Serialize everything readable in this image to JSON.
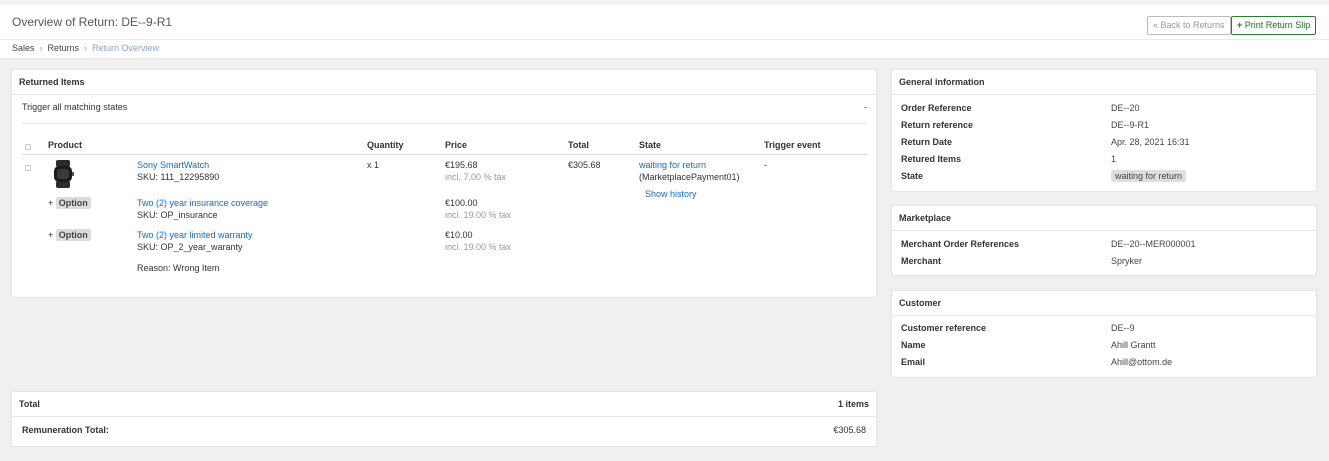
{
  "page": {
    "title": "Overview of Return: DE--9-R1",
    "back_button": "« Back to Returns",
    "print_button": "Print Return Slip",
    "breadcrumb": [
      "Sales",
      "Returns",
      "Return Overview"
    ]
  },
  "returned_items": {
    "title": "Returned Items",
    "trigger_label": "Trigger all matching states",
    "trigger_value": "-",
    "columns": [
      "Product",
      "Quantity",
      "Price",
      "Total",
      "State",
      "Trigger event"
    ],
    "item": {
      "name": "Sony SmartWatch",
      "sku": "SKU: 111_12295890",
      "quantity": "x 1",
      "price": "€195.68",
      "tax": "incl. 7.00 % tax",
      "total": "€305.68",
      "state": "waiting for return",
      "state_process": "(MarketplacePayment01)",
      "show_history": "Show history",
      "trigger_event": "-"
    },
    "options": [
      {
        "plus": "+",
        "badge": "Option",
        "name": "Two (2) year insurance coverage",
        "sku": "SKU: OP_insurance",
        "price": "€100.00",
        "tax": "incl. 19.00 % tax"
      },
      {
        "plus": "+",
        "badge": "Option",
        "name": "Two (2) year limited warranty",
        "sku": "SKU: OP_2_year_waranty",
        "price": "€10.00",
        "tax": "incl. 19.00 % tax"
      }
    ],
    "reason": "Reason: Wrong Item"
  },
  "totals": {
    "title": "Total",
    "items_count": "1 items",
    "remuneration_label": "Remuneration Total:",
    "remuneration_value": "€305.68"
  },
  "general_info": {
    "title": "General information",
    "order_reference_label": "Order Reference",
    "order_reference_value": "DE--20",
    "return_reference_label": "Return reference",
    "return_reference_value": "DE--9-R1",
    "return_date_label": "Return Date",
    "return_date_value": "Apr. 28, 2021 16:31",
    "returned_items_label": "Retured Items",
    "returned_items_value": "1",
    "state_label": "State",
    "state_value": "waiting for return"
  },
  "marketplace": {
    "title": "Marketplace",
    "merchant_order_ref_label": "Merchant Order References",
    "merchant_order_ref_value": "DE--20--MER000001",
    "merchant_label": "Merchant",
    "merchant_value": "Spryker"
  },
  "customer": {
    "title": "Customer",
    "reference_label": "Customer reference",
    "reference_value": "DE--9",
    "name_label": "Name",
    "name_value": "Ahill Grantt",
    "email_label": "Email",
    "email_value": "Ahill@ottom.de"
  },
  "colors": {
    "link": "#1a6bb5",
    "print_button": "#2e7d32",
    "badge_bg": "#dedede",
    "page_bg": "#f0f0f0"
  },
  "icons": {
    "print_button_icon": "plus-icon",
    "product_thumbnail": "smartwatch-image"
  }
}
